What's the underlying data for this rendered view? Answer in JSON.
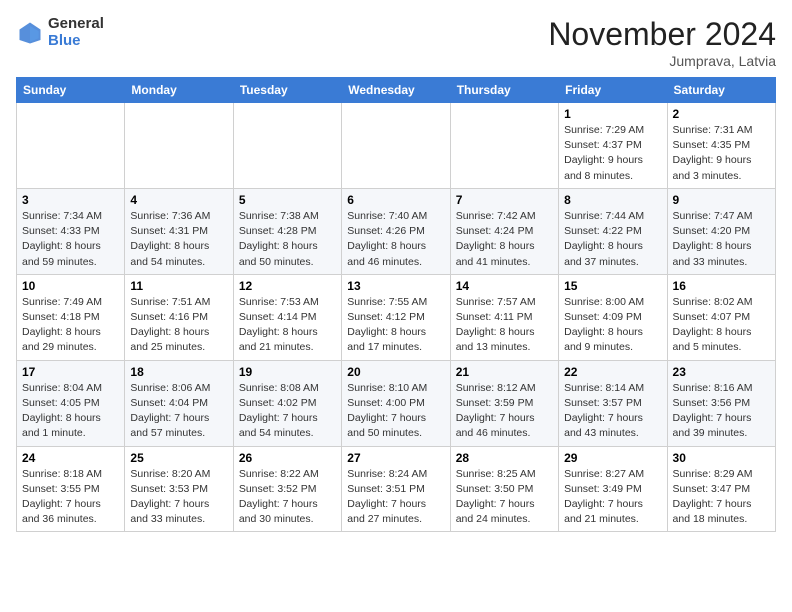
{
  "logo": {
    "general": "General",
    "blue": "Blue"
  },
  "header": {
    "month": "November 2024",
    "location": "Jumprava, Latvia"
  },
  "days_of_week": [
    "Sunday",
    "Monday",
    "Tuesday",
    "Wednesday",
    "Thursday",
    "Friday",
    "Saturday"
  ],
  "weeks": [
    [
      {
        "day": "",
        "info": ""
      },
      {
        "day": "",
        "info": ""
      },
      {
        "day": "",
        "info": ""
      },
      {
        "day": "",
        "info": ""
      },
      {
        "day": "",
        "info": ""
      },
      {
        "day": "1",
        "info": "Sunrise: 7:29 AM\nSunset: 4:37 PM\nDaylight: 9 hours\nand 8 minutes."
      },
      {
        "day": "2",
        "info": "Sunrise: 7:31 AM\nSunset: 4:35 PM\nDaylight: 9 hours\nand 3 minutes."
      }
    ],
    [
      {
        "day": "3",
        "info": "Sunrise: 7:34 AM\nSunset: 4:33 PM\nDaylight: 8 hours\nand 59 minutes."
      },
      {
        "day": "4",
        "info": "Sunrise: 7:36 AM\nSunset: 4:31 PM\nDaylight: 8 hours\nand 54 minutes."
      },
      {
        "day": "5",
        "info": "Sunrise: 7:38 AM\nSunset: 4:28 PM\nDaylight: 8 hours\nand 50 minutes."
      },
      {
        "day": "6",
        "info": "Sunrise: 7:40 AM\nSunset: 4:26 PM\nDaylight: 8 hours\nand 46 minutes."
      },
      {
        "day": "7",
        "info": "Sunrise: 7:42 AM\nSunset: 4:24 PM\nDaylight: 8 hours\nand 41 minutes."
      },
      {
        "day": "8",
        "info": "Sunrise: 7:44 AM\nSunset: 4:22 PM\nDaylight: 8 hours\nand 37 minutes."
      },
      {
        "day": "9",
        "info": "Sunrise: 7:47 AM\nSunset: 4:20 PM\nDaylight: 8 hours\nand 33 minutes."
      }
    ],
    [
      {
        "day": "10",
        "info": "Sunrise: 7:49 AM\nSunset: 4:18 PM\nDaylight: 8 hours\nand 29 minutes."
      },
      {
        "day": "11",
        "info": "Sunrise: 7:51 AM\nSunset: 4:16 PM\nDaylight: 8 hours\nand 25 minutes."
      },
      {
        "day": "12",
        "info": "Sunrise: 7:53 AM\nSunset: 4:14 PM\nDaylight: 8 hours\nand 21 minutes."
      },
      {
        "day": "13",
        "info": "Sunrise: 7:55 AM\nSunset: 4:12 PM\nDaylight: 8 hours\nand 17 minutes."
      },
      {
        "day": "14",
        "info": "Sunrise: 7:57 AM\nSunset: 4:11 PM\nDaylight: 8 hours\nand 13 minutes."
      },
      {
        "day": "15",
        "info": "Sunrise: 8:00 AM\nSunset: 4:09 PM\nDaylight: 8 hours\nand 9 minutes."
      },
      {
        "day": "16",
        "info": "Sunrise: 8:02 AM\nSunset: 4:07 PM\nDaylight: 8 hours\nand 5 minutes."
      }
    ],
    [
      {
        "day": "17",
        "info": "Sunrise: 8:04 AM\nSunset: 4:05 PM\nDaylight: 8 hours\nand 1 minute."
      },
      {
        "day": "18",
        "info": "Sunrise: 8:06 AM\nSunset: 4:04 PM\nDaylight: 7 hours\nand 57 minutes."
      },
      {
        "day": "19",
        "info": "Sunrise: 8:08 AM\nSunset: 4:02 PM\nDaylight: 7 hours\nand 54 minutes."
      },
      {
        "day": "20",
        "info": "Sunrise: 8:10 AM\nSunset: 4:00 PM\nDaylight: 7 hours\nand 50 minutes."
      },
      {
        "day": "21",
        "info": "Sunrise: 8:12 AM\nSunset: 3:59 PM\nDaylight: 7 hours\nand 46 minutes."
      },
      {
        "day": "22",
        "info": "Sunrise: 8:14 AM\nSunset: 3:57 PM\nDaylight: 7 hours\nand 43 minutes."
      },
      {
        "day": "23",
        "info": "Sunrise: 8:16 AM\nSunset: 3:56 PM\nDaylight: 7 hours\nand 39 minutes."
      }
    ],
    [
      {
        "day": "24",
        "info": "Sunrise: 8:18 AM\nSunset: 3:55 PM\nDaylight: 7 hours\nand 36 minutes."
      },
      {
        "day": "25",
        "info": "Sunrise: 8:20 AM\nSunset: 3:53 PM\nDaylight: 7 hours\nand 33 minutes."
      },
      {
        "day": "26",
        "info": "Sunrise: 8:22 AM\nSunset: 3:52 PM\nDaylight: 7 hours\nand 30 minutes."
      },
      {
        "day": "27",
        "info": "Sunrise: 8:24 AM\nSunset: 3:51 PM\nDaylight: 7 hours\nand 27 minutes."
      },
      {
        "day": "28",
        "info": "Sunrise: 8:25 AM\nSunset: 3:50 PM\nDaylight: 7 hours\nand 24 minutes."
      },
      {
        "day": "29",
        "info": "Sunrise: 8:27 AM\nSunset: 3:49 PM\nDaylight: 7 hours\nand 21 minutes."
      },
      {
        "day": "30",
        "info": "Sunrise: 8:29 AM\nSunset: 3:47 PM\nDaylight: 7 hours\nand 18 minutes."
      }
    ]
  ]
}
